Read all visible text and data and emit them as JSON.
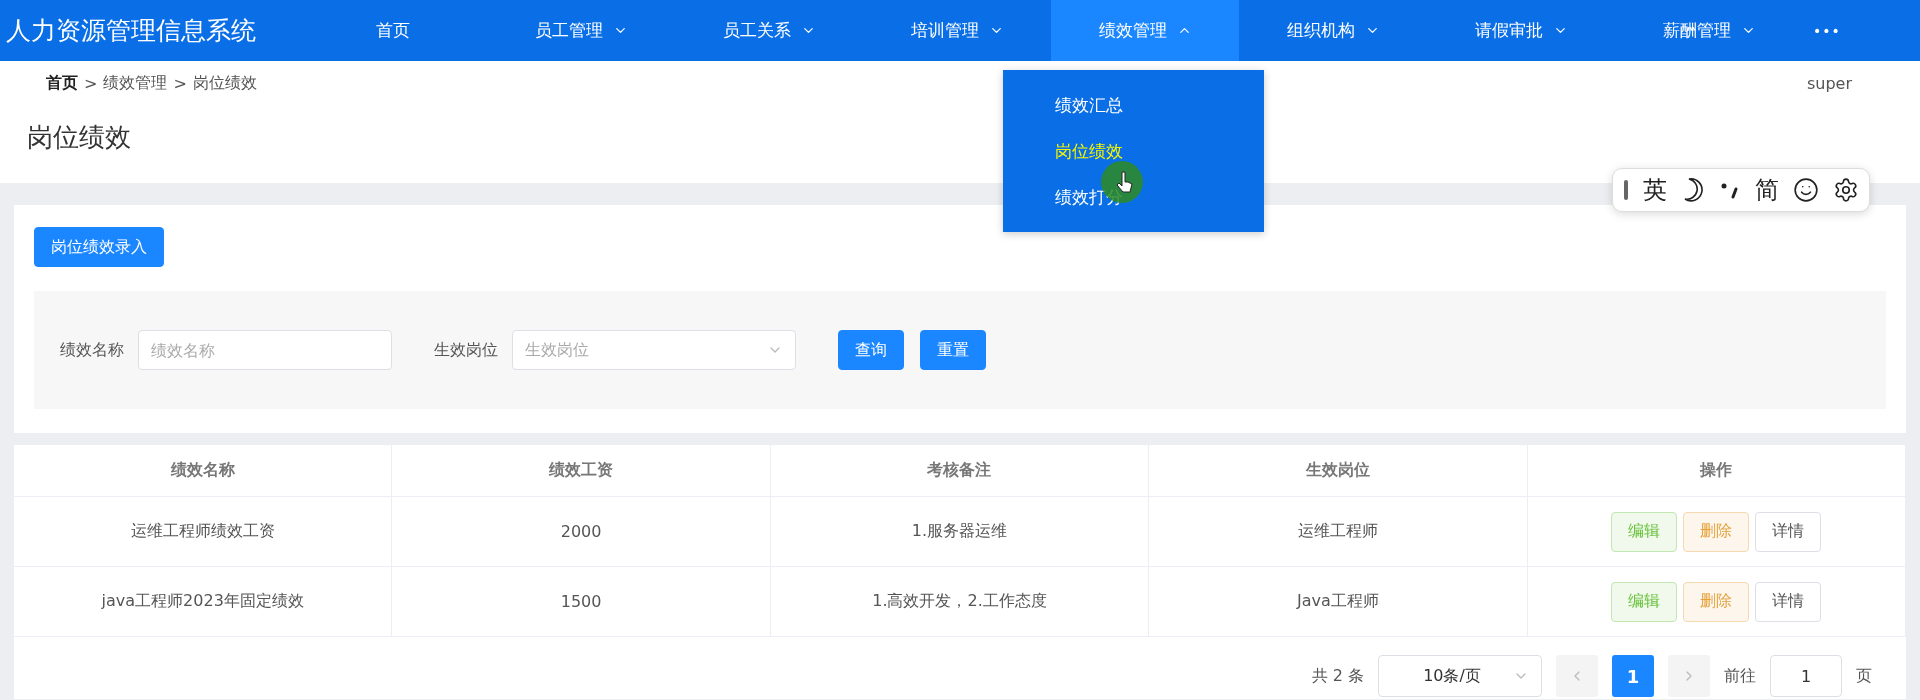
{
  "header": {
    "title": "人力资源管理信息系统",
    "nav": [
      {
        "label": "首页",
        "has_submenu": false,
        "selected": false
      },
      {
        "label": "员工管理",
        "has_submenu": true,
        "expanded": false,
        "selected": false
      },
      {
        "label": "员工关系",
        "has_submenu": true,
        "expanded": false,
        "selected": false
      },
      {
        "label": "培训管理",
        "has_submenu": true,
        "expanded": false,
        "selected": false
      },
      {
        "label": "绩效管理",
        "has_submenu": true,
        "expanded": true,
        "selected": true
      },
      {
        "label": "组织机构",
        "has_submenu": true,
        "expanded": false,
        "selected": false
      },
      {
        "label": "请假审批",
        "has_submenu": true,
        "expanded": false,
        "selected": false
      },
      {
        "label": "薪酬管理",
        "has_submenu": true,
        "expanded": false,
        "selected": false
      }
    ],
    "more": "•••"
  },
  "dropdown": {
    "items": [
      {
        "label": "绩效汇总",
        "selected": false
      },
      {
        "label": "岗位绩效",
        "selected": true
      },
      {
        "label": "绩效打分",
        "selected": false
      }
    ]
  },
  "breadcrumb": [
    {
      "label": "首页",
      "separator": ">"
    },
    {
      "label": "绩效管理",
      "separator": ">"
    },
    {
      "label": "岗位绩效"
    }
  ],
  "user": "super",
  "page_title": "岗位绩效",
  "add_button": "岗位绩效录入",
  "filters": [
    {
      "kind": "input",
      "label": "绩效名称",
      "placeholder": "绩效名称"
    },
    {
      "kind": "select",
      "label": "生效岗位",
      "placeholder": "生效岗位"
    }
  ],
  "search_buttons": [
    {
      "label": "查询"
    },
    {
      "label": "重置"
    }
  ],
  "table": {
    "columns": [
      "绩效名称",
      "绩效工资",
      "考核备注",
      "生效岗位",
      "操作"
    ],
    "rows": [
      {
        "cells": [
          "运维工程师绩效工资",
          "2000",
          "1.服务器运维",
          "运维工程师"
        ],
        "actions": [
          {
            "kind": "edit",
            "label": "编辑"
          },
          {
            "kind": "delete",
            "label": "删除"
          },
          {
            "kind": "detail",
            "label": "详情"
          }
        ]
      },
      {
        "cells": [
          "java工程师2023年固定绩效",
          "1500",
          "1.高效开发，2.工作态度",
          "Java工程师"
        ],
        "actions": [
          {
            "kind": "edit",
            "label": "编辑"
          },
          {
            "kind": "delete",
            "label": "删除"
          },
          {
            "kind": "detail",
            "label": "详情"
          }
        ]
      }
    ]
  },
  "pagination": {
    "total": "共 2 条",
    "page_size": "10条/页",
    "pages": [
      {
        "label": "1",
        "selected": true
      }
    ],
    "jump_label": "前往",
    "jump_value": "1",
    "jump_suffix": "页"
  },
  "ime": {
    "items": [
      {
        "kind": "grip"
      },
      {
        "kind": "text",
        "label": "英"
      },
      {
        "kind": "moon"
      },
      {
        "kind": "punct"
      },
      {
        "kind": "text",
        "label": "简"
      },
      {
        "kind": "emoji"
      },
      {
        "kind": "gear"
      }
    ]
  }
}
